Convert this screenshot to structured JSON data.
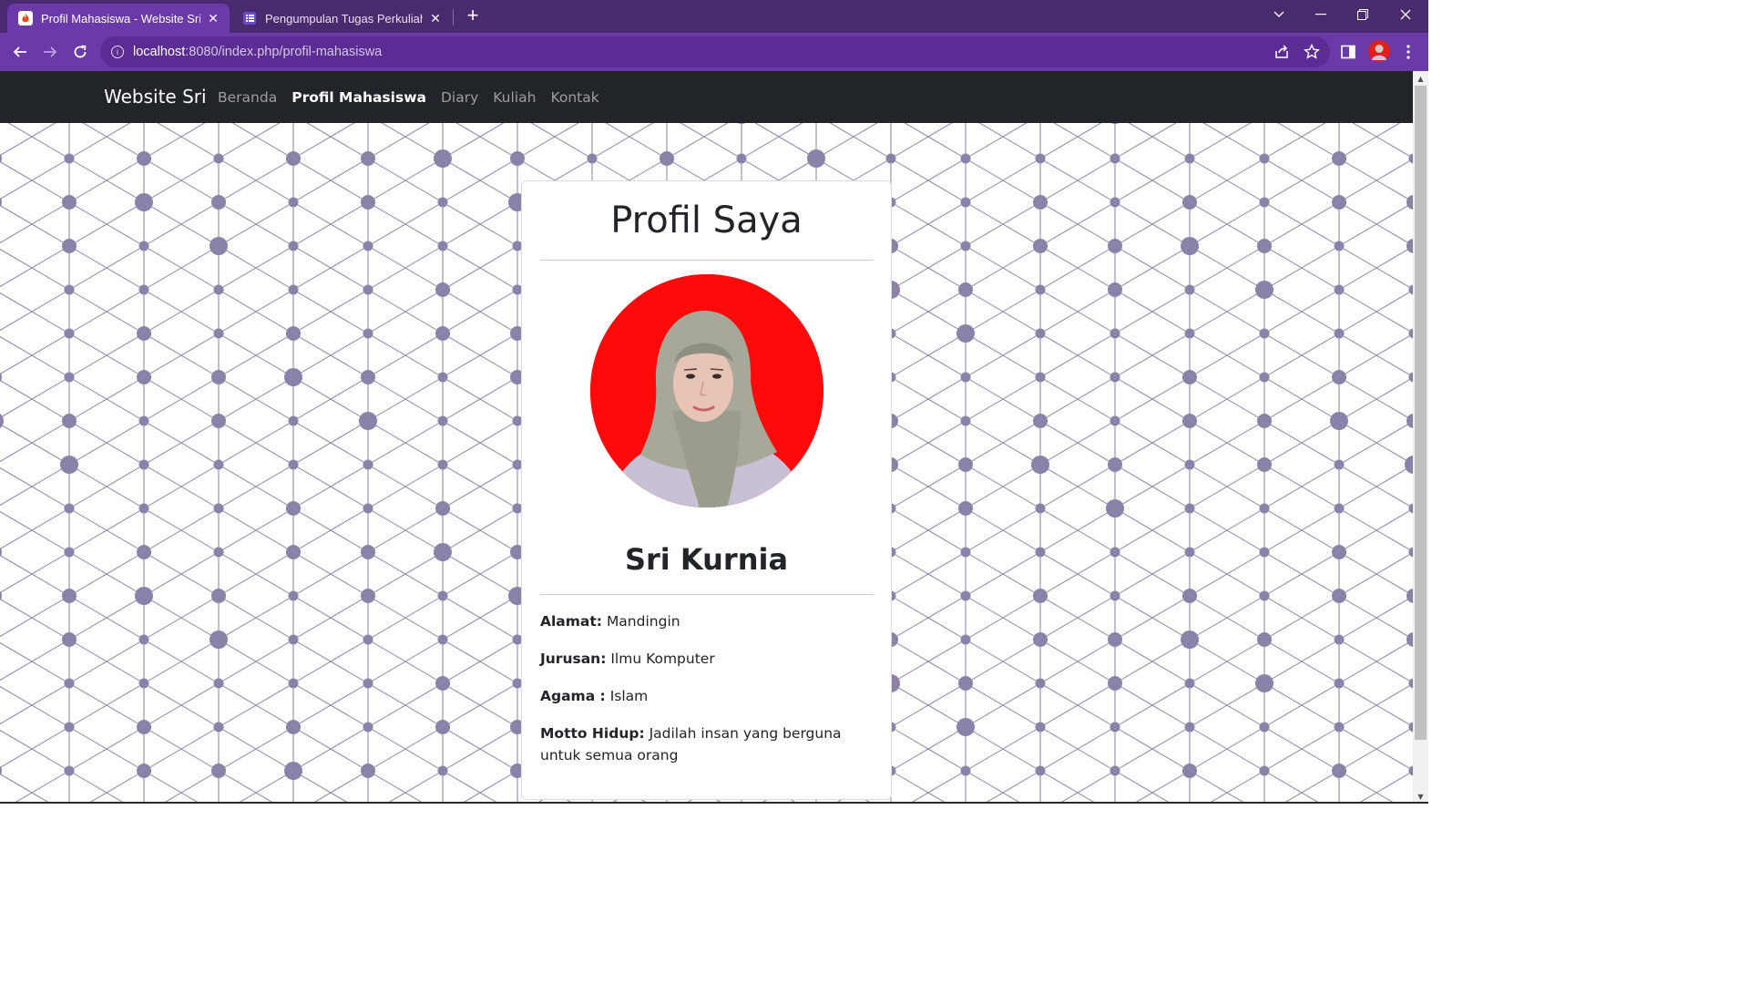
{
  "browser": {
    "tabs": [
      {
        "title": "Profil Mahasiswa - Website Sri",
        "active": true,
        "icon": "flame-favicon-icon"
      },
      {
        "title": "Pengumpulan Tugas Perkuliahan",
        "active": false,
        "icon": "form-list-favicon-icon"
      }
    ],
    "url_host": "localhost",
    "url_rest": ":8080/index.php/profil-mahasiswa",
    "accent": "#6a3aa8",
    "tabbar_color": "#4a2a6e"
  },
  "site": {
    "brand": "Website Sri",
    "nav": [
      {
        "label": "Beranda",
        "active": false
      },
      {
        "label": "Profil Mahasiswa",
        "active": true
      },
      {
        "label": "Diary",
        "active": false
      },
      {
        "label": "Kuliah",
        "active": false
      },
      {
        "label": "Kontak",
        "active": false
      }
    ],
    "navbar_color": "#212529",
    "pattern_color": "#8a82a8"
  },
  "profile": {
    "heading": "Profil Saya",
    "name": "Sri Kurnia",
    "photo_bg": "#ff0a0a",
    "fields": [
      {
        "label": "Alamat:",
        "value": "Mandingin"
      },
      {
        "label": "Jurusan:",
        "value": "Ilmu Komputer"
      },
      {
        "label": "Agama :",
        "value": "Islam"
      },
      {
        "label": "Motto Hidup:",
        "value": "Jadilah insan yang berguna untuk semua orang"
      }
    ]
  }
}
